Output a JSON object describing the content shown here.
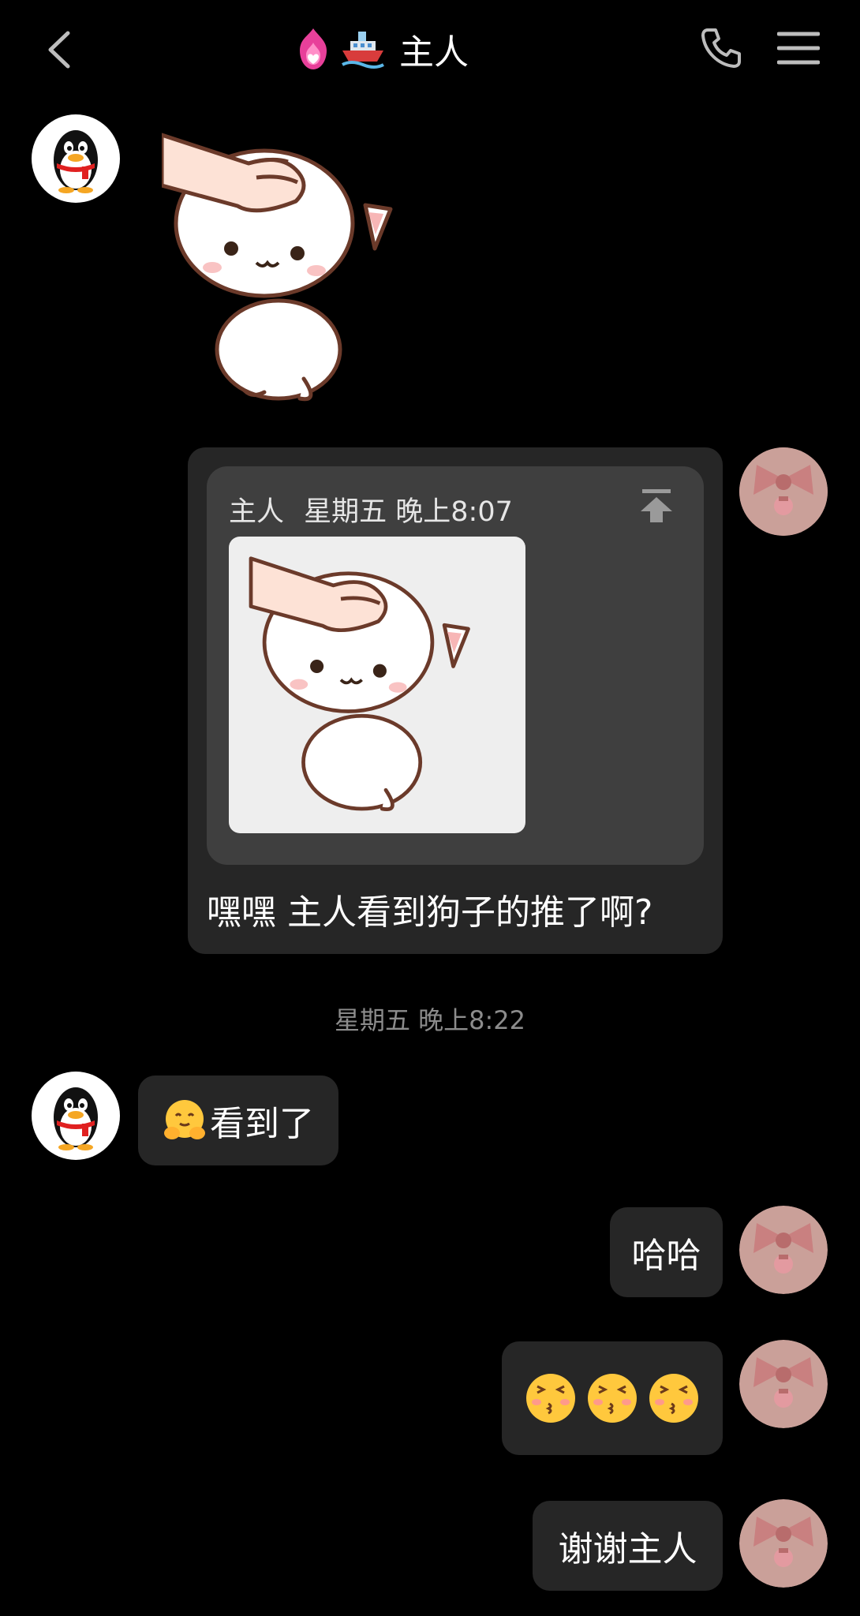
{
  "header": {
    "title": "主人",
    "badges": [
      "fire-heart-icon",
      "ship-icon"
    ],
    "icons": [
      "back-chevron-icon",
      "phone-icon",
      "hamburger-menu-icon"
    ]
  },
  "messages": [
    {
      "side": "left",
      "type": "sticker",
      "sticker": "cat-headpat-sticker"
    },
    {
      "side": "right",
      "type": "quote",
      "quote": {
        "sender": "主人",
        "time": "星期五 晚上8:07",
        "content": "cat-headpat-sticker"
      },
      "text": "嘿嘿 主人看到狗子的推了啊?"
    },
    {
      "side": "center",
      "type": "timestamp",
      "text": "星期五 晚上8:22"
    },
    {
      "side": "left",
      "type": "text",
      "emoji": "hugging-face-emoji",
      "text": "看到了"
    },
    {
      "side": "right",
      "type": "text",
      "text": "哈哈"
    },
    {
      "side": "right",
      "type": "emoji",
      "emojis": [
        "kissing-emoji",
        "kissing-emoji",
        "kissing-emoji"
      ]
    },
    {
      "side": "right",
      "type": "text",
      "text": "谢谢主人"
    }
  ],
  "colors": {
    "background": "#000000",
    "bubble": "#262626",
    "quote_inner": "#3f3f3f",
    "timestamp": "#8c8c8c"
  }
}
